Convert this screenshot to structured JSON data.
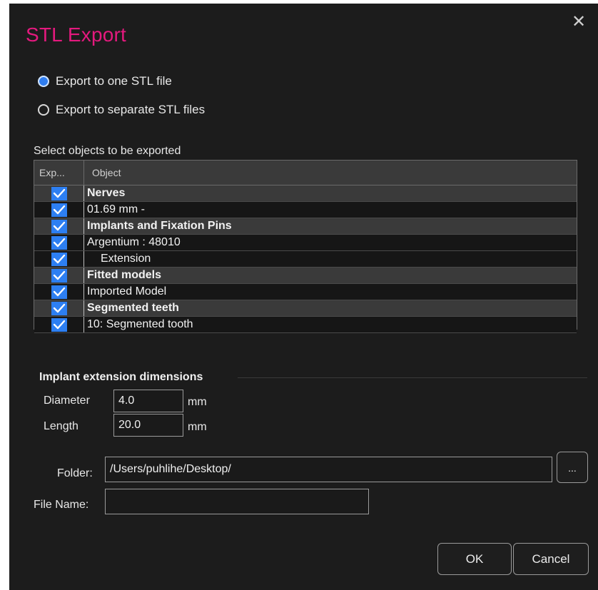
{
  "dialog": {
    "title": "STL Export",
    "close_icon": "close-icon",
    "title_color": "#e4197e"
  },
  "export_mode": {
    "options": [
      {
        "label": "Export to one STL file",
        "selected": true
      },
      {
        "label": "Export to separate STL files",
        "selected": false
      }
    ]
  },
  "objects": {
    "section_label": "Select objects to be exported",
    "columns": {
      "export": "Exp...",
      "object": "Object"
    },
    "rows": [
      {
        "label": "Nerves",
        "type": "group",
        "checked": true
      },
      {
        "label": "01.69 mm -",
        "type": "item",
        "checked": true
      },
      {
        "label": "Implants and Fixation Pins",
        "type": "group",
        "checked": true
      },
      {
        "label": "Argentium : 48010",
        "type": "item",
        "checked": true
      },
      {
        "label": "Extension",
        "type": "subitem",
        "checked": true
      },
      {
        "label": "Fitted models",
        "type": "group",
        "checked": true
      },
      {
        "label": "Imported Model",
        "type": "item",
        "checked": true
      },
      {
        "label": "Segmented teeth",
        "type": "group",
        "checked": true
      },
      {
        "label": "10: Segmented tooth",
        "type": "item",
        "checked": true
      }
    ]
  },
  "extension": {
    "title": "Implant extension dimensions",
    "diameter_label": "Diameter",
    "diameter_value": "4.0",
    "diameter_unit": "mm",
    "length_label": "Length",
    "length_value": "20.0",
    "length_unit": "mm"
  },
  "output": {
    "folder_label": "Folder:",
    "folder_value": "/Users/puhlihe/Desktop/",
    "browse_label": "...",
    "filename_label": "File Name:",
    "filename_value": ""
  },
  "buttons": {
    "ok": "OK",
    "cancel": "Cancel"
  },
  "colors": {
    "accent": "#2d7ff2",
    "background": "#1c1c1c"
  }
}
